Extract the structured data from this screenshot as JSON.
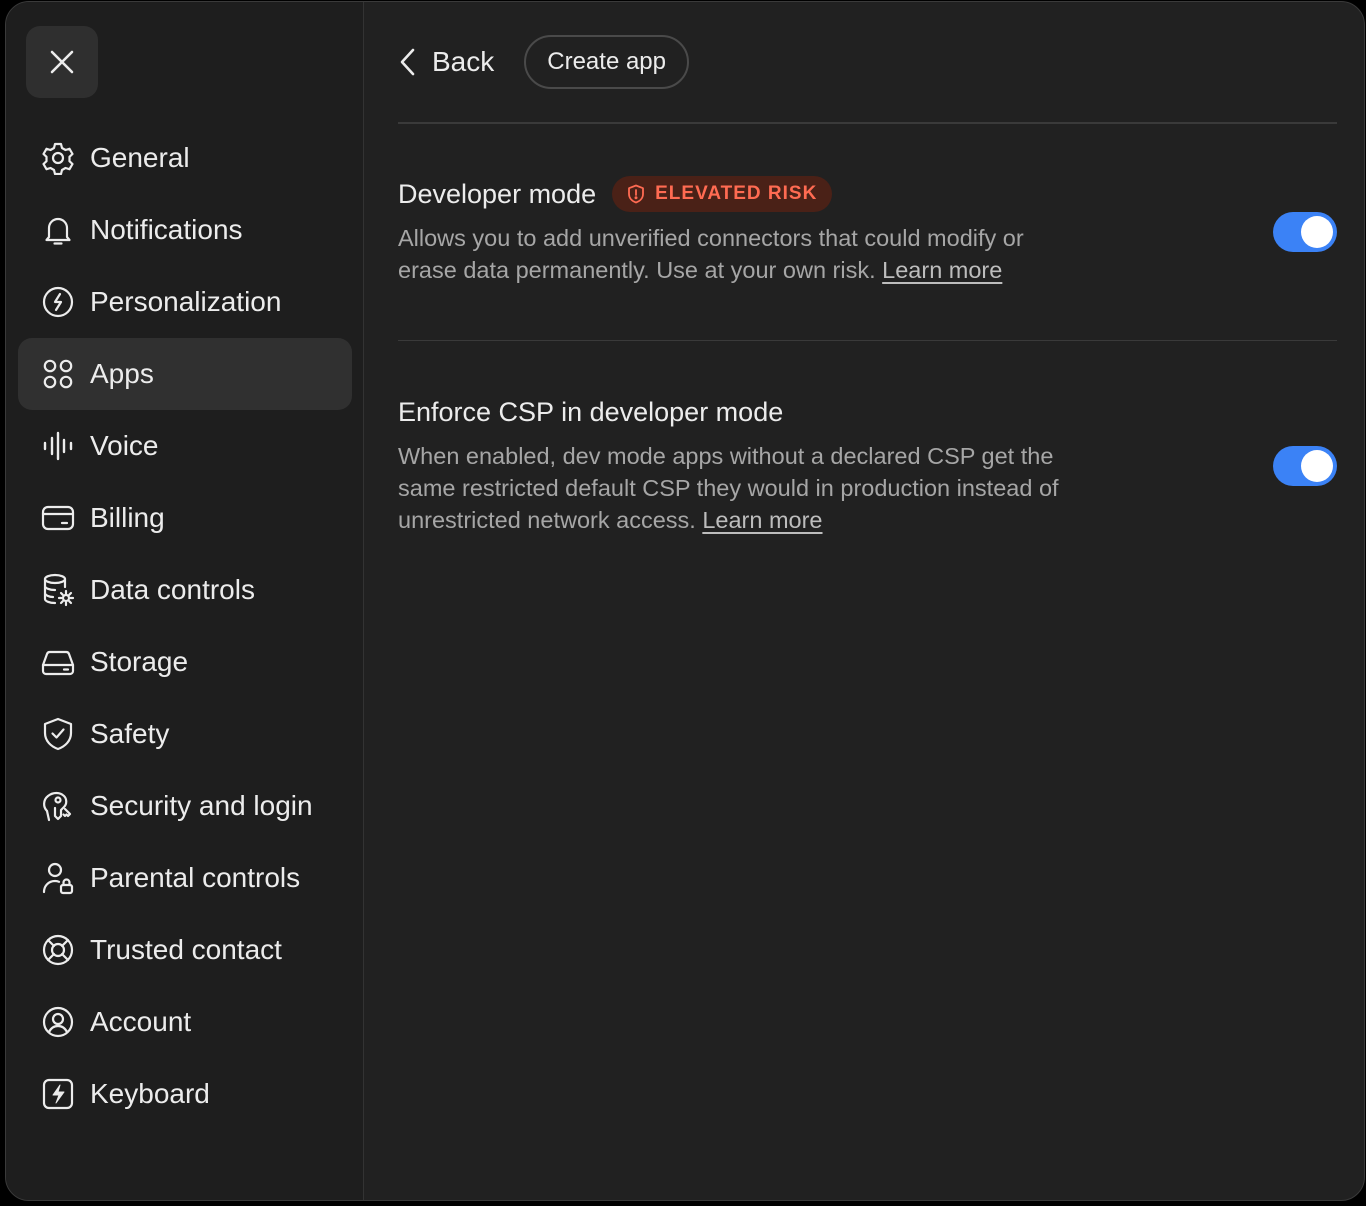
{
  "sidebar": {
    "close_icon": "close-icon",
    "items": [
      {
        "label": "General",
        "icon": "gear-icon"
      },
      {
        "label": "Notifications",
        "icon": "bell-icon"
      },
      {
        "label": "Personalization",
        "icon": "personalization-icon"
      },
      {
        "label": "Apps",
        "icon": "apps-grid-icon",
        "active": true
      },
      {
        "label": "Voice",
        "icon": "voice-waveform-icon"
      },
      {
        "label": "Billing",
        "icon": "credit-card-icon"
      },
      {
        "label": "Data controls",
        "icon": "database-gear-icon"
      },
      {
        "label": "Storage",
        "icon": "storage-drive-icon"
      },
      {
        "label": "Safety",
        "icon": "shield-check-icon"
      },
      {
        "label": "Security and login",
        "icon": "security-icon"
      },
      {
        "label": "Parental controls",
        "icon": "parental-lock-icon"
      },
      {
        "label": "Trusted contact",
        "icon": "lifebuoy-icon"
      },
      {
        "label": "Account",
        "icon": "account-icon"
      },
      {
        "label": "Keyboard",
        "icon": "keyboard-bolt-icon"
      }
    ]
  },
  "header": {
    "back_label": "Back",
    "create_app_label": "Create app"
  },
  "settings": {
    "developer_mode": {
      "title": "Developer mode",
      "badge": "ELEVATED RISK",
      "description": "Allows you to add unverified connectors that could modify or erase data permanently. Use at your own risk.",
      "link": "Learn more",
      "enabled": true
    },
    "enforce_csp": {
      "title": "Enforce CSP in developer mode",
      "description": "When enabled, dev mode apps without a declared CSP get the same restricted default CSP they would in production instead of unrestricted network access.",
      "link": "Learn more",
      "enabled": true
    }
  },
  "colors": {
    "accent": "#3b82f6",
    "risk_text": "#ff6b52",
    "risk_bg": "#4a2117",
    "background": "#212121"
  }
}
